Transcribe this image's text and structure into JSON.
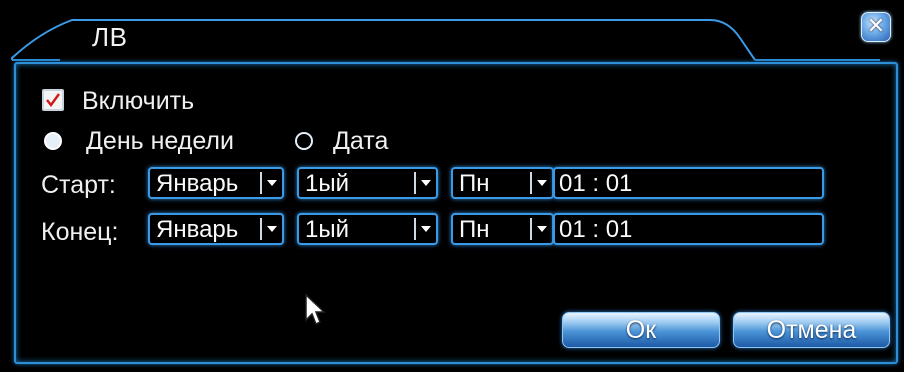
{
  "window": {
    "title": "ЛВ",
    "close_icon": "close-icon"
  },
  "enable": {
    "label": "Включить",
    "checked": true
  },
  "mode": {
    "options": [
      {
        "label": "День недели",
        "selected": true
      },
      {
        "label": "Дата",
        "selected": false
      }
    ]
  },
  "start": {
    "label": "Старт:",
    "month": "Январь",
    "week": "1ый",
    "day": "Пн",
    "time": "01 : 01"
  },
  "end": {
    "label": "Конец:",
    "month": "Январь",
    "week": "1ый",
    "day": "Пн",
    "time": "01 : 01"
  },
  "buttons": {
    "ok": "Ок",
    "cancel": "Отмена"
  },
  "colors": {
    "border_accent": "#2d8fd8",
    "background": "#000000",
    "text": "#f0f0f0",
    "button_top": "#e9f4ff",
    "button_bottom": "#1d5aa6"
  }
}
